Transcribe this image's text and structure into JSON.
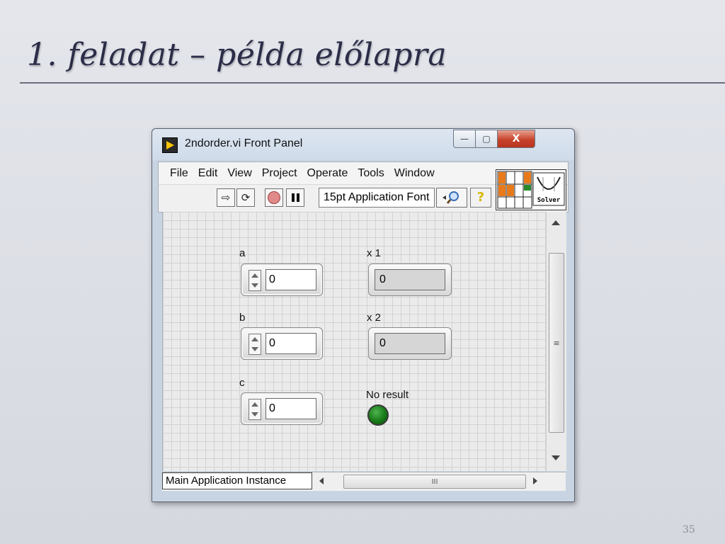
{
  "slide": {
    "title": "1. feladat – példa előlapra",
    "page_number": "35"
  },
  "window": {
    "title": "2ndorder.vi Front Panel",
    "buttons": {
      "minimize": "—",
      "maximize": "▢",
      "close": "X"
    }
  },
  "menu": [
    "File",
    "Edit",
    "View",
    "Project",
    "Operate",
    "Tools",
    "Window"
  ],
  "toolbar": {
    "font": "15pt Application Font",
    "help": "?",
    "vi_icon_label": "Solver"
  },
  "controls": {
    "a": {
      "label": "a",
      "value": "0"
    },
    "b": {
      "label": "b",
      "value": "0"
    },
    "c": {
      "label": "c",
      "value": "0"
    }
  },
  "indicators": {
    "x1": {
      "label": "x 1",
      "value": "0"
    },
    "x2": {
      "label": "x 2",
      "value": "0"
    },
    "no_result": {
      "label": "No result",
      "state": "green"
    }
  },
  "statusbar": {
    "instance": "Main Application Instance",
    "thumb_grip": "III"
  },
  "scrollbar": {
    "grip": "≡"
  },
  "colors": {
    "led_on": "#1f8a1f",
    "close_button": "#c8432c",
    "title_text": "#2b2d48"
  }
}
